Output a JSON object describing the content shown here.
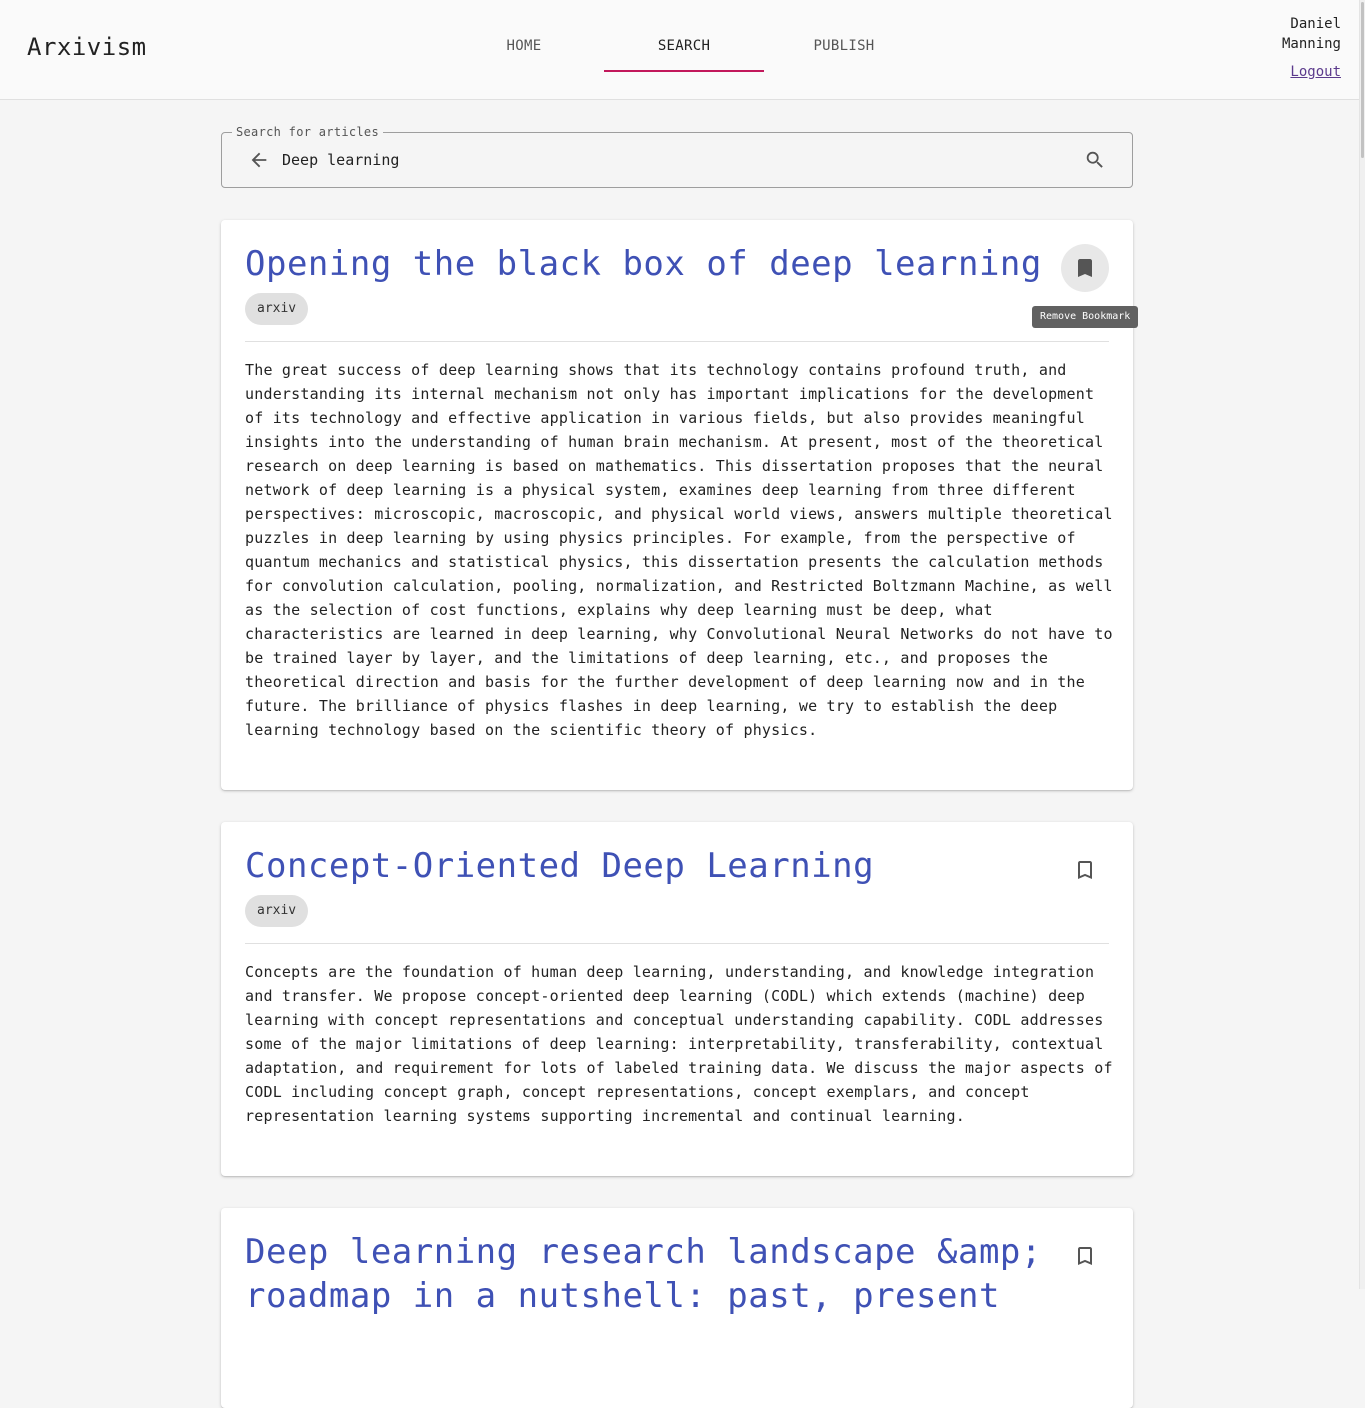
{
  "app": {
    "title": "Arxivism"
  },
  "nav": {
    "tabs": [
      {
        "label": "HOME",
        "active": false
      },
      {
        "label": "SEARCH",
        "active": true
      },
      {
        "label": "PUBLISH",
        "active": false
      }
    ],
    "indicator_color": "#c2185b"
  },
  "user": {
    "name": "Daniel Manning",
    "logout_label": "Logout"
  },
  "search": {
    "legend": "Search for articles",
    "value": "Deep learning",
    "back_icon": "arrow-left-icon",
    "search_icon": "search-icon"
  },
  "results": [
    {
      "title": "Opening the black box of deep learning",
      "source": "arxiv",
      "bookmarked": true,
      "tooltip": "Remove Bookmark",
      "abstract": "The great success of deep learning shows that its technology contains profound truth, and understanding its internal mechanism not only has important implications for the development of its technology and effective application in various fields, but also provides meaningful insights into the understanding of human brain mechanism. At present, most of the theoretical research on deep learning is based on mathematics. This dissertation proposes that the neural network of deep learning is a physical system, examines deep learning from three different perspectives: microscopic, macroscopic, and physical world views, answers multiple theoretical puzzles in deep learning by using physics principles. For example, from the perspective of quantum mechanics and statistical physics, this dissertation presents the calculation methods for convolution calculation, pooling, normalization, and Restricted Boltzmann Machine, as well as the selection of cost functions, explains why deep learning must be deep, what characteristics are learned in deep learning, why Convolutional Neural Networks do not have to be trained layer by layer, and the limitations of deep learning, etc., and proposes the theoretical direction and basis for the further development of deep learning now and in the future. The brilliance of physics flashes in deep learning, we try to establish the deep learning technology based on the scientific theory of physics."
    },
    {
      "title": "Concept-Oriented Deep Learning",
      "source": "arxiv",
      "bookmarked": false,
      "abstract": "Concepts are the foundation of human deep learning, understanding, and knowledge integration and transfer. We propose concept-oriented deep learning (CODL) which extends (machine) deep learning with concept representations and conceptual understanding capability. CODL addresses some of the major limitations of deep learning: interpretability, transferability, contextual adaptation, and requirement for lots of labeled training data. We discuss the major aspects of CODL including concept graph, concept representations, concept exemplars, and concept representation learning systems supporting incremental and continual learning."
    },
    {
      "title": "Deep learning research landscape &amp; roadmap in a nutshell: past, present",
      "bookmarked": false
    }
  ],
  "colors": {
    "title": "#3f51b5",
    "background": "#f5f5f5",
    "card": "#ffffff",
    "chip": "#e0e0e0",
    "tooltip": "#616161",
    "link": "#5b3a8c"
  }
}
